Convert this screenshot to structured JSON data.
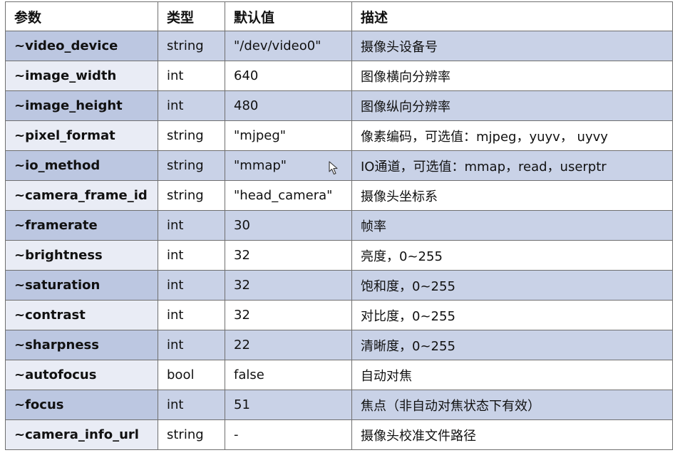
{
  "table": {
    "headers": [
      "参数",
      "类型",
      "默认值",
      "描述"
    ],
    "rows": [
      [
        "~video_device",
        "string",
        "\"/dev/video0\"",
        "摄像头设备号"
      ],
      [
        "~image_width",
        "int",
        "640",
        "图像横向分辨率"
      ],
      [
        "~image_height",
        "int",
        "480",
        "图像纵向分辨率"
      ],
      [
        "~pixel_format",
        "string",
        "\"mjpeg\"",
        "像素编码，可选值：mjpeg，yuyv，  uyvy"
      ],
      [
        "~io_method",
        "string",
        "\"mmap\"",
        "IO通道，可选值：mmap，read，userptr"
      ],
      [
        "~camera_frame_id",
        "string",
        "\"head_camera\"",
        "摄像头坐标系"
      ],
      [
        "~framerate",
        "int",
        "30",
        "帧率"
      ],
      [
        "~brightness",
        "int",
        "32",
        "亮度，0~255"
      ],
      [
        "~saturation",
        "int",
        "32",
        "饱和度，0~255"
      ],
      [
        "~contrast",
        "int",
        "32",
        "对比度，0~255"
      ],
      [
        "~sharpness",
        "int",
        "22",
        "清晰度，0~255"
      ],
      [
        "~autofocus",
        "bool",
        "false",
        "自动对焦"
      ],
      [
        "~focus",
        "int",
        "51",
        "焦点（非自动对焦状态下有效）"
      ],
      [
        "~camera_info_url",
        "string",
        "-",
        "摄像头校准文件路径"
      ]
    ]
  },
  "colors": {
    "row_shaded": "#c9d2e7",
    "row_plain": "#ffffff",
    "border": "#6f6f6f",
    "text": "#111111"
  },
  "icons": {
    "cursor": "mouse-pointer-icon"
  }
}
